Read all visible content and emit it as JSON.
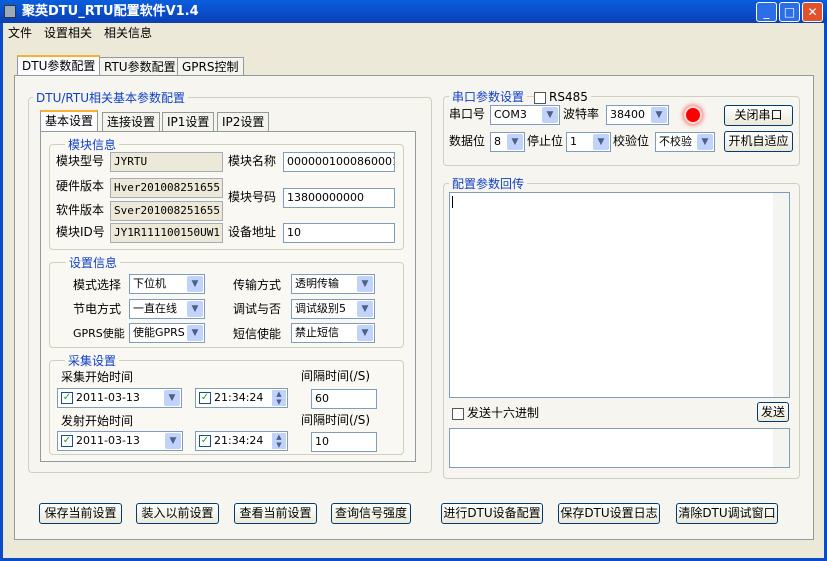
{
  "window": {
    "title": "聚英DTU_RTU配置软件V1.4",
    "min": "_",
    "max": "□",
    "close": "✕"
  },
  "menu": [
    "文件",
    "设置相关",
    "相关信息"
  ],
  "main_tabs": [
    "DTU参数配置",
    "RTU参数配置",
    "GPRS控制"
  ],
  "basic_group": "DTU/RTU相关基本参数配置",
  "inner_tabs": [
    "基本设置",
    "连接设置",
    "IP1设置",
    "IP2设置"
  ],
  "module": {
    "title": "模块信息",
    "type_label": "模块型号",
    "type": "JYRTU",
    "hw_label": "硬件版本",
    "hw": "Hver201008251655",
    "sw_label": "软件版本",
    "sw": "Sver201008251655",
    "id_label": "模块ID号",
    "id": "JY1R111100150UW1",
    "name_label": "模块名称",
    "name": "0000001000860001",
    "num_label": "模块号码",
    "num": "13800000000",
    "addr_label": "设备地址",
    "addr": "10"
  },
  "settings": {
    "title": "设置信息",
    "mode_label": "模式选择",
    "mode": "下位机",
    "power_label": "节电方式",
    "power": "一直在线",
    "gprs_label": "GPRS使能",
    "gprs": "使能GPRS",
    "trans_label": "传输方式",
    "trans": "透明传输",
    "debug_label": "调试与否",
    "debug": "调试级别5",
    "sms_label": "短信使能",
    "sms": "禁止短信"
  },
  "collect": {
    "title": "采集设置",
    "collect_start_label": "采集开始时间",
    "collect_date": "2011-03-13",
    "collect_time": "21:34:24",
    "interval_label": "间隔时间(/S)",
    "collect_interval": "60",
    "send_start_label": "发射开始时间",
    "send_date": "2011-03-13",
    "send_time": "21:34:24",
    "send_interval": "10"
  },
  "serial": {
    "title": "串口参数设置",
    "rs485": "RS485",
    "port_label": "串口号",
    "port": "COM3",
    "baud_label": "波特率",
    "baud": "38400",
    "data_label": "数据位",
    "data": "8",
    "stop_label": "停止位",
    "stop": "1",
    "parity_label": "校验位",
    "parity": "不校验",
    "close_btn": "关闭串口",
    "auto_btn": "开机自适应",
    "status_color": "#ff0000"
  },
  "echo": {
    "title": "配置参数回传",
    "hex_label": "发送十六进制",
    "send_btn": "发送"
  },
  "bottom_buttons": [
    "保存当前设置",
    "装入以前设置",
    "查看当前设置",
    "查询信号强度",
    "进行DTU设备配置",
    "保存DTU设置日志",
    "清除DTU调试窗口"
  ]
}
